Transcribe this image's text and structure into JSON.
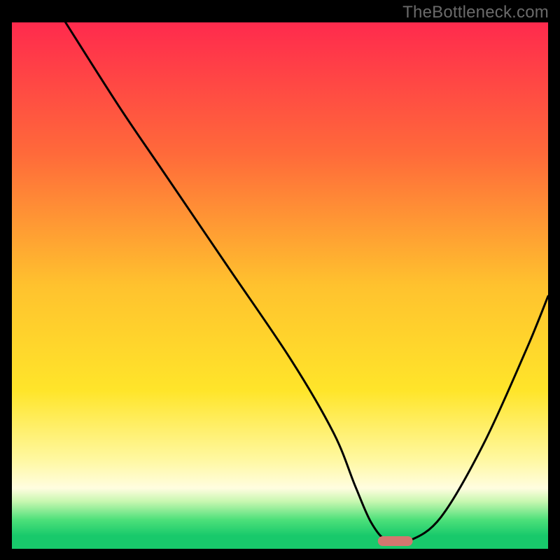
{
  "watermark": "TheBottleneck.com",
  "chart_data": {
    "type": "line",
    "title": "",
    "xlabel": "",
    "ylabel": "",
    "xlim": [
      0,
      100
    ],
    "ylim": [
      0,
      100
    ],
    "grid": false,
    "legend": false,
    "gradient_stops": [
      {
        "offset": 0,
        "color": "#ff2a4d"
      },
      {
        "offset": 0.25,
        "color": "#ff6a3a"
      },
      {
        "offset": 0.5,
        "color": "#ffc22e"
      },
      {
        "offset": 0.7,
        "color": "#ffe52a"
      },
      {
        "offset": 0.83,
        "color": "#fff8a0"
      },
      {
        "offset": 0.885,
        "color": "#fffde0"
      },
      {
        "offset": 0.91,
        "color": "#c8f7b0"
      },
      {
        "offset": 0.945,
        "color": "#4de07a"
      },
      {
        "offset": 0.975,
        "color": "#18c96b"
      },
      {
        "offset": 1.0,
        "color": "#18c96b"
      }
    ],
    "series": [
      {
        "name": "bottleneck-curve",
        "stroke": "#000000",
        "x": [
          10,
          20,
          28,
          40,
          52,
          60,
          64,
          67,
          70,
          74,
          80,
          88,
          96,
          100
        ],
        "y": [
          100,
          84,
          72,
          54,
          36,
          22,
          12,
          5,
          1.5,
          1.5,
          6,
          20,
          38,
          48
        ]
      }
    ],
    "marker": {
      "name": "optimum-marker",
      "x_center": 71.5,
      "width": 6.5,
      "color": "#d3776f"
    }
  }
}
